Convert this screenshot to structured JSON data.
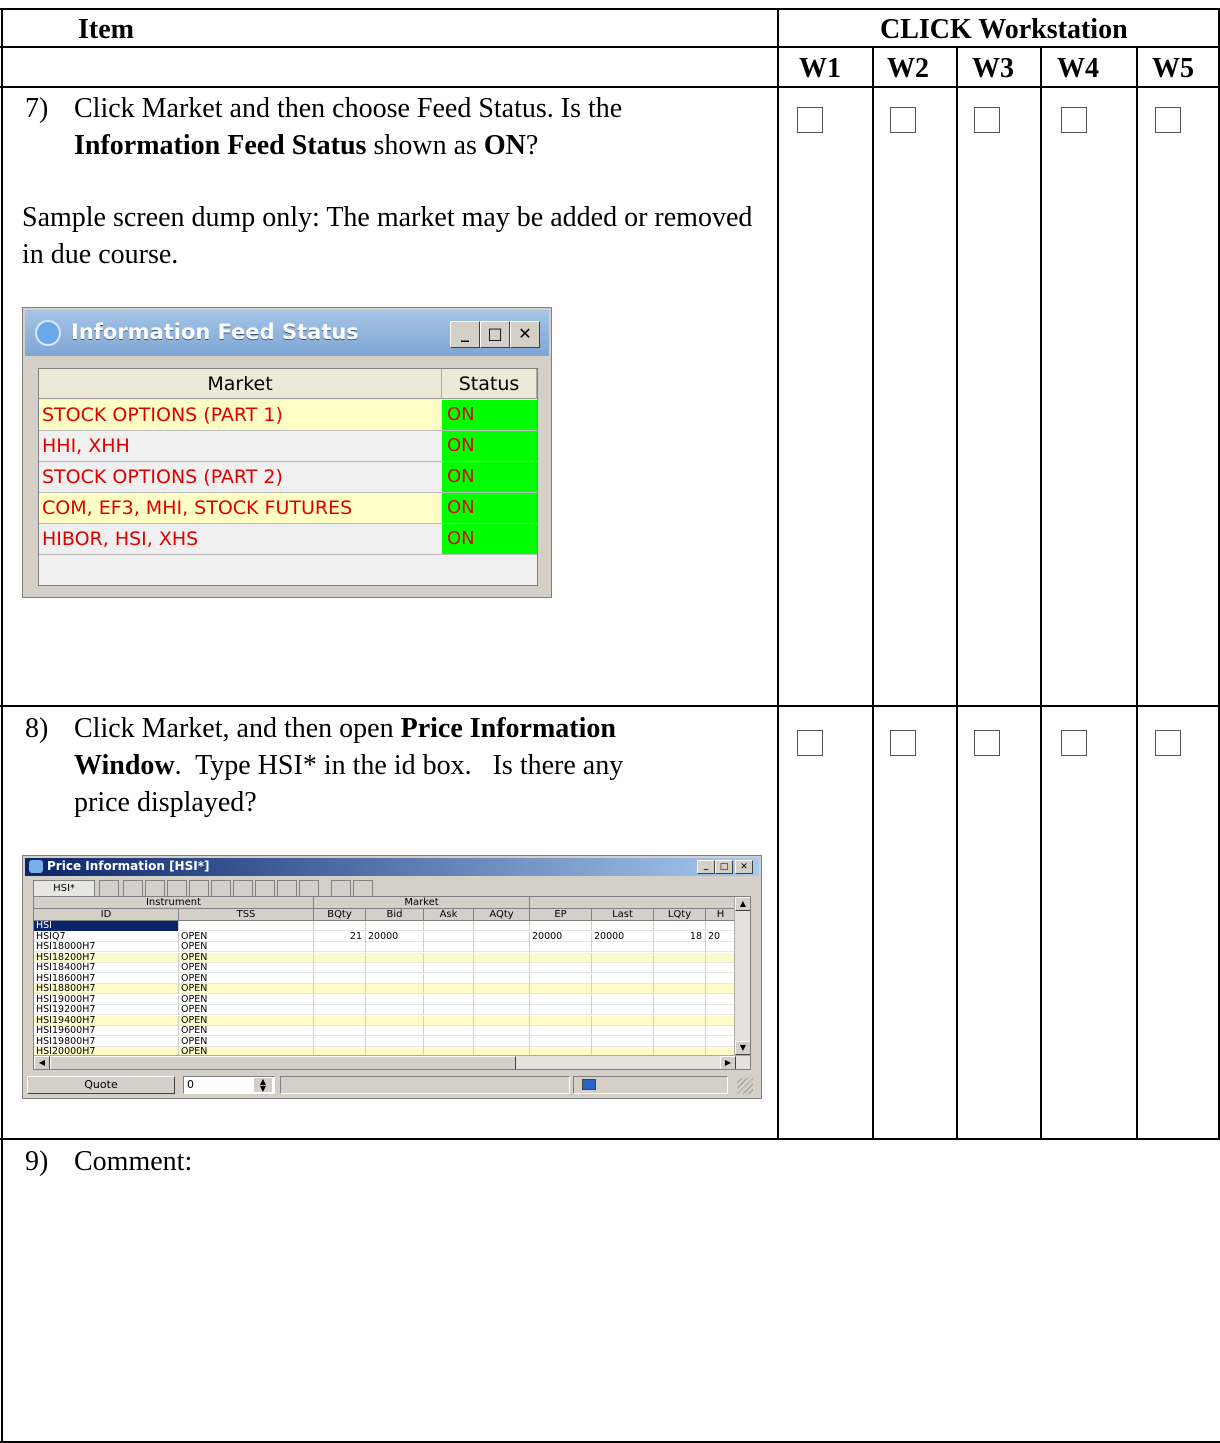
{
  "header": {
    "item_label": "Item",
    "group_label": "CLICK Workstation",
    "workstations": [
      "W1",
      "W2",
      "W3",
      "W4",
      "W5"
    ]
  },
  "items": [
    {
      "number": "7)",
      "line1": "Click Market and then choose Feed Status.  Is the",
      "line2_bold": "Information Feed Status",
      "line2_mid": " shown as ",
      "line2_bold2": "ON",
      "line2_end": "?",
      "note": "Sample screen dump only: The market may be added or removed in due course."
    },
    {
      "number": "8)",
      "line1_pre": "Click Market, and then open ",
      "line1_bold": "Price Information",
      "line2_bold": "Window",
      "line2_rest": ".  Type HSI* in the id box.   Is there any",
      "line3": "price displayed?"
    },
    {
      "number": "9)",
      "text": "Comment:"
    }
  ],
  "feed_status_window": {
    "title": "Information Feed Status",
    "columns": [
      "Market",
      "Status"
    ],
    "rows": [
      {
        "market": "STOCK OPTIONS (PART 1)",
        "status": "ON",
        "bg": "#ffffc6"
      },
      {
        "market": "HHI, XHH",
        "status": "ON",
        "bg": "#f0f0f0"
      },
      {
        "market": "STOCK OPTIONS (PART 2)",
        "status": "ON",
        "bg": "#f0f0f0"
      },
      {
        "market": "COM, EF3, MHI, STOCK FUTURES",
        "status": "ON",
        "bg": "#ffffc6"
      },
      {
        "market": "HIBOR, HSI, XHS",
        "status": "ON",
        "bg": "#f0f0f0"
      }
    ]
  },
  "price_window": {
    "title": "Price Information [HSI*]",
    "tab_active": "HSI*",
    "group_headers": [
      "Instrument",
      "Market"
    ],
    "columns": [
      "ID",
      "TSS",
      "BQty",
      "Bid",
      "Ask",
      "AQty",
      "EP",
      "Last",
      "LQty",
      "H"
    ],
    "rows": [
      {
        "id": "HSI",
        "tss": "",
        "bqty": "",
        "bid": "",
        "ask": "",
        "aqty": "",
        "ep": "",
        "last": "",
        "lqty": "",
        "h": "",
        "selected": true
      },
      {
        "id": "HSIQ7",
        "tss": "OPEN",
        "bqty": "21",
        "bid": "20000",
        "ask": "",
        "aqty": "",
        "ep": "20000",
        "last": "20000",
        "lqty": "18",
        "h": "20"
      },
      {
        "id": "HSI18000H7",
        "tss": "OPEN",
        "bqty": "",
        "bid": "",
        "ask": "",
        "aqty": "",
        "ep": "",
        "last": "",
        "lqty": "",
        "h": ""
      },
      {
        "id": "HSI18200H7",
        "tss": "OPEN",
        "bqty": "",
        "bid": "",
        "ask": "",
        "aqty": "",
        "ep": "",
        "last": "",
        "lqty": "",
        "h": "",
        "yellow": true
      },
      {
        "id": "HSI18400H7",
        "tss": "OPEN",
        "bqty": "",
        "bid": "",
        "ask": "",
        "aqty": "",
        "ep": "",
        "last": "",
        "lqty": "",
        "h": ""
      },
      {
        "id": "HSI18600H7",
        "tss": "OPEN",
        "bqty": "",
        "bid": "",
        "ask": "",
        "aqty": "",
        "ep": "",
        "last": "",
        "lqty": "",
        "h": ""
      },
      {
        "id": "HSI18800H7",
        "tss": "OPEN",
        "bqty": "",
        "bid": "",
        "ask": "",
        "aqty": "",
        "ep": "",
        "last": "",
        "lqty": "",
        "h": "",
        "yellow": true
      },
      {
        "id": "HSI19000H7",
        "tss": "OPEN",
        "bqty": "",
        "bid": "",
        "ask": "",
        "aqty": "",
        "ep": "",
        "last": "",
        "lqty": "",
        "h": ""
      },
      {
        "id": "HSI19200H7",
        "tss": "OPEN",
        "bqty": "",
        "bid": "",
        "ask": "",
        "aqty": "",
        "ep": "",
        "last": "",
        "lqty": "",
        "h": ""
      },
      {
        "id": "HSI19400H7",
        "tss": "OPEN",
        "bqty": "",
        "bid": "",
        "ask": "",
        "aqty": "",
        "ep": "",
        "last": "",
        "lqty": "",
        "h": "",
        "yellow": true
      },
      {
        "id": "HSI19600H7",
        "tss": "OPEN",
        "bqty": "",
        "bid": "",
        "ask": "",
        "aqty": "",
        "ep": "",
        "last": "",
        "lqty": "",
        "h": ""
      },
      {
        "id": "HSI19800H7",
        "tss": "OPEN",
        "bqty": "",
        "bid": "",
        "ask": "",
        "aqty": "",
        "ep": "",
        "last": "",
        "lqty": "",
        "h": ""
      },
      {
        "id": "HSI20000H7",
        "tss": "OPEN",
        "bqty": "",
        "bid": "",
        "ask": "",
        "aqty": "",
        "ep": "",
        "last": "",
        "lqty": "",
        "h": "",
        "yellow": true
      }
    ],
    "status_quote_label": "Quote",
    "status_spin_value": "0"
  }
}
